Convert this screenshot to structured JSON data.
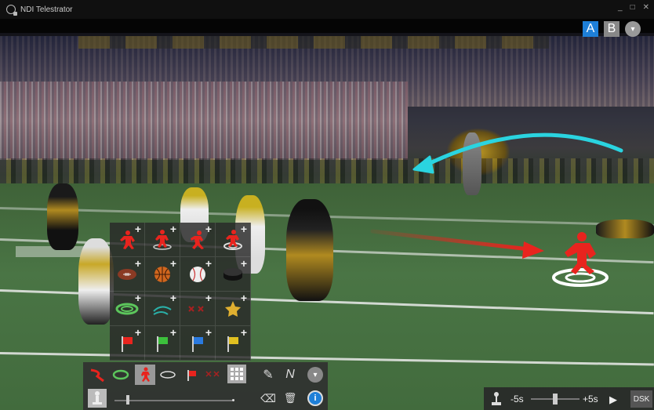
{
  "window": {
    "title": "NDI Telestrator",
    "controls": [
      "_",
      "□",
      "✕"
    ]
  },
  "view_buttons": {
    "a": "A",
    "b": "B",
    "menu_glyph": "▾"
  },
  "palette": {
    "rows": [
      [
        {
          "icon": "player-red-icon"
        },
        {
          "icon": "player-target-red-icon"
        },
        {
          "icon": "player-running-red-icon"
        },
        {
          "icon": "player-ring-red-icon"
        }
      ],
      [
        {
          "icon": "football-icon"
        },
        {
          "icon": "basketball-icon"
        },
        {
          "icon": "baseball-icon"
        },
        {
          "icon": "hockey-puck-icon"
        }
      ],
      [
        {
          "icon": "ring-green-icon"
        },
        {
          "icon": "arrow-teal-icon"
        },
        {
          "icon": "x-marks-red-icon"
        },
        {
          "icon": "star-gold-icon"
        }
      ],
      [
        {
          "icon": "flag-red-icon"
        },
        {
          "icon": "flag-green-icon"
        },
        {
          "icon": "flag-blue-icon"
        },
        {
          "icon": "flag-yellow-icon"
        }
      ]
    ],
    "plus_glyph": "+"
  },
  "toolbar": {
    "tools": [
      "arrow-curve-tool-icon",
      "ring-tool-icon",
      "player-tool-icon",
      "ellipse-tool-icon",
      "flag-tool-icon",
      "x-tool-icon",
      "grid-tool-icon"
    ],
    "selected_tool": "player-tool-icon",
    "size_slider_level": 0.1,
    "pen_label": "✎",
    "line_label": "N",
    "eraser_label": "⌫",
    "trash_label": "🗑",
    "info_label": "i",
    "more_label": "▾"
  },
  "playback": {
    "rewind_label": "-5s",
    "forward_label": "+5s",
    "play_glyph": "▶",
    "dsk_label": "DSK",
    "scrub_position": 0.5
  },
  "colors": {
    "accent_blue": "#1e7fd8",
    "draw_red": "#e8241e",
    "draw_cyan": "#2ad4e0",
    "toolbar_bg": "#303030"
  }
}
